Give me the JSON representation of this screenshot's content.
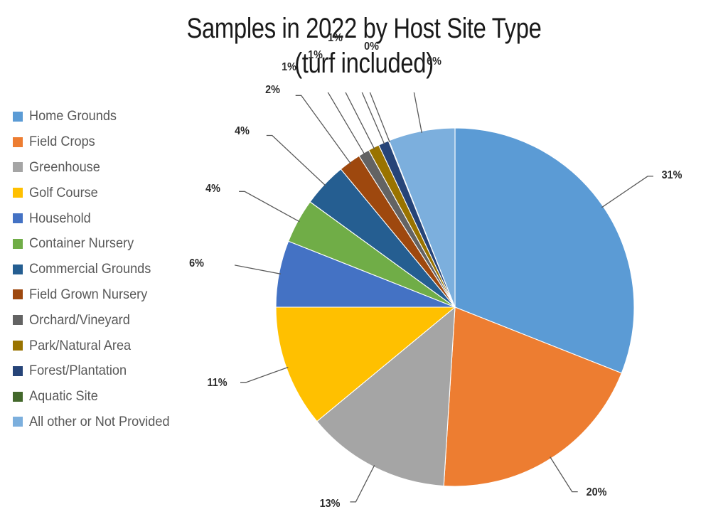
{
  "chart_data": {
    "type": "pie",
    "title": "Samples in 2022 by Host Site Type",
    "subtitle": "(turf included)",
    "title_lines": [
      "Samples in 2022 by Host Site Type",
      "(turf included)"
    ],
    "xlabel": "",
    "ylabel": "",
    "legend_position": "left",
    "grid": false,
    "value_unit": "percent",
    "start_angle_deg": 0,
    "direction": "clockwise",
    "categories": [
      "Home Grounds",
      "Field Crops",
      "Greenhouse",
      "Golf Course",
      "Household",
      "Container Nursery",
      "Commercial Grounds",
      "Field Grown Nursery",
      "Orchard/Vineyard",
      "Park/Natural Area",
      "Forest/Plantation",
      "Aquatic Site",
      "All other or Not Provided"
    ],
    "values": [
      31,
      20,
      13,
      11,
      6,
      4,
      4,
      2,
      1,
      1,
      1,
      0,
      6
    ],
    "data_labels": [
      "31%",
      "20%",
      "13%",
      "11%",
      "6%",
      "4%",
      "4%",
      "2%",
      "1%",
      "1%",
      "1%",
      "0%",
      "6%"
    ],
    "colors": [
      "#5b9bd5",
      "#ed7d31",
      "#a5a5a5",
      "#ffc000",
      "#4472c4",
      "#70ad47",
      "#255e91",
      "#9e480e",
      "#636363",
      "#997300",
      "#264478",
      "#43682b",
      "#7cafdd"
    ]
  },
  "legend": {
    "items": [
      {
        "label": "Home Grounds",
        "color": "#5b9bd5"
      },
      {
        "label": "Field Crops",
        "color": "#ed7d31"
      },
      {
        "label": "Greenhouse",
        "color": "#a5a5a5"
      },
      {
        "label": "Golf Course",
        "color": "#ffc000"
      },
      {
        "label": "Household",
        "color": "#4472c4"
      },
      {
        "label": "Container Nursery",
        "color": "#70ad47"
      },
      {
        "label": "Commercial Grounds",
        "color": "#255e91"
      },
      {
        "label": "Field Grown Nursery",
        "color": "#9e480e"
      },
      {
        "label": "Orchard/Vineyard",
        "color": "#636363"
      },
      {
        "label": "Park/Natural Area",
        "color": "#997300"
      },
      {
        "label": "Forest/Plantation",
        "color": "#264478"
      },
      {
        "label": "Aquatic Site",
        "color": "#43682b"
      },
      {
        "label": "All other or Not Provided",
        "color": "#7cafdd"
      }
    ]
  }
}
